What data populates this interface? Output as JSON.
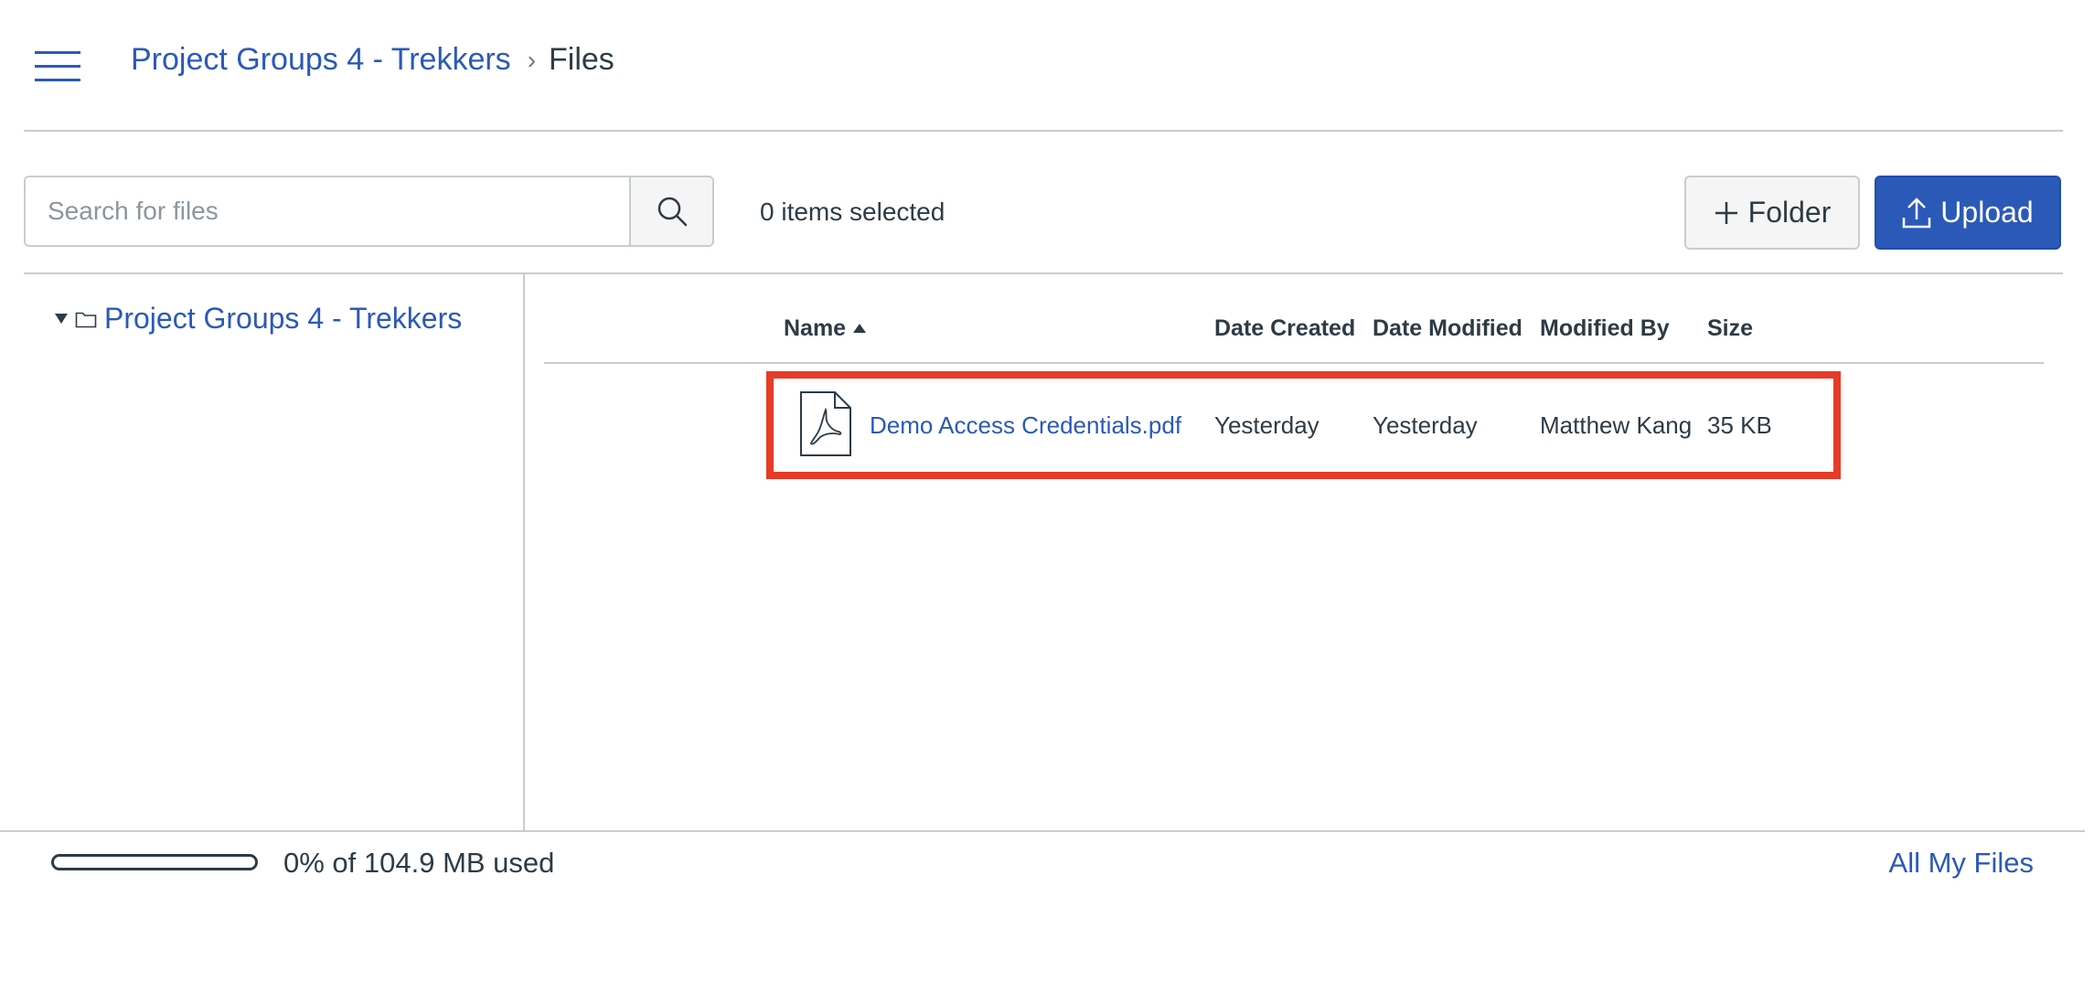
{
  "header": {
    "menu_icon": "hamburger-menu-icon",
    "breadcrumb": {
      "group": "Project Groups 4 - Trekkers",
      "separator": "›",
      "current": "Files"
    }
  },
  "toolbar": {
    "search_placeholder": "Search for files",
    "search_icon": "magnifier-icon",
    "selected_count": "0 items selected",
    "folder_button": {
      "icon": "plus-icon",
      "label": "Folder"
    },
    "upload_button": {
      "icon": "upload-icon",
      "label": "Upload"
    }
  },
  "tree": {
    "root": {
      "label": "Project Groups 4 - Trekkers",
      "expanded": true,
      "icon": "folder-icon"
    }
  },
  "table": {
    "columns": [
      "Name",
      "Date Created",
      "Date Modified",
      "Modified By",
      "Size"
    ],
    "sort": {
      "column": "Name",
      "direction": "ascending"
    },
    "rows": [
      {
        "icon": "pdf-file-icon",
        "name": "Demo Access Credentials.pdf",
        "date_created": "Yesterday",
        "date_modified": "Yesterday",
        "modified_by": "Matthew Kang",
        "size": "35 KB",
        "highlighted": true
      }
    ]
  },
  "footer": {
    "quota_percent": 0,
    "quota_text": "0% of 104.9 MB used",
    "all_files_link": "All My Files"
  },
  "colors": {
    "accent": "#2b59b8",
    "highlight": "#e53b27",
    "text": "#2d3b45",
    "divider": "#c7cdd1"
  }
}
